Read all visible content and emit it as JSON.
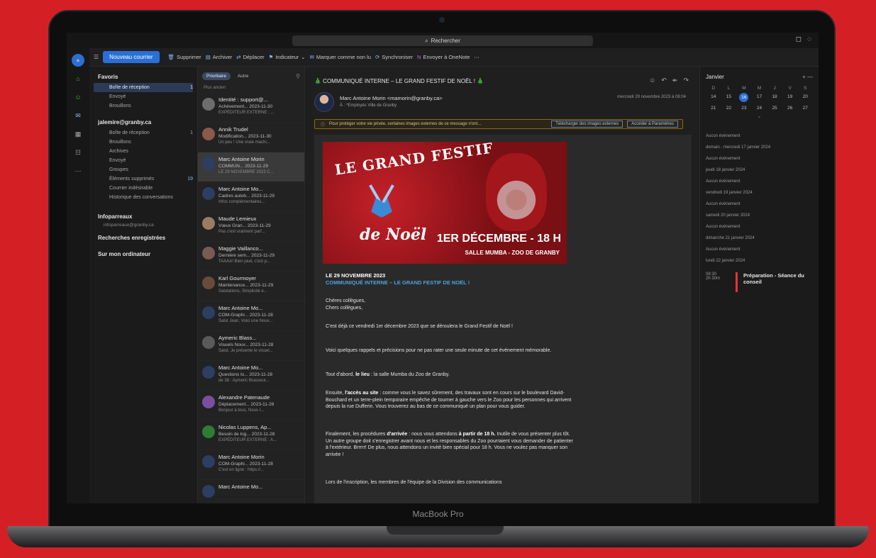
{
  "device": {
    "label": "MacBook Pro"
  },
  "search": {
    "placeholder": "Rechercher",
    "icon": "search-icon"
  },
  "toolbar": {
    "new_mail": "Nouveau courrier",
    "actions": [
      {
        "icon": "trash-icon",
        "label": "Supprimer"
      },
      {
        "icon": "archive-icon",
        "label": "Archiver"
      },
      {
        "icon": "move-icon",
        "label": "Déplacer"
      },
      {
        "icon": "flag-icon",
        "label": "Indicateur"
      },
      {
        "icon": "mark-read-icon",
        "label": "Marquer comme non lu"
      },
      {
        "icon": "sync-icon",
        "label": "Synchroniser"
      },
      {
        "icon": "onenote-icon",
        "label": "Envoyer à OneNote"
      }
    ]
  },
  "folders": {
    "favorites_label": "Favoris",
    "favorites": [
      {
        "label": "Boîte de réception",
        "count": "1"
      },
      {
        "label": "Envoyé",
        "count": ""
      },
      {
        "label": "Brouillons",
        "count": ""
      }
    ],
    "account_label": "jalemire@granby.ca",
    "account_items": [
      {
        "label": "Boîte de réception",
        "count": "1"
      },
      {
        "label": "Brouillons",
        "count": ""
      },
      {
        "label": "Archives",
        "count": ""
      },
      {
        "label": "Envoyé",
        "count": ""
      },
      {
        "label": "Groupes",
        "count": ""
      },
      {
        "label": "Éléments supprimés",
        "count": "19"
      },
      {
        "label": "Courrier indésirable",
        "count": ""
      },
      {
        "label": "Historique des conversations",
        "count": ""
      }
    ],
    "shared_label": "Infoparreaux",
    "shared_sub": "infoparreaux@granby.ca",
    "saved_searches": "Recherches enregistrées",
    "on_computer": "Sur mon ordinateur"
  },
  "msglist": {
    "tab_focused": "Prioritaire",
    "tab_other": "Autre",
    "section": "Plus ancien",
    "messages": [
      {
        "from": "Identité : support@...",
        "subject": "Achèvement... 2023-11-30",
        "preview": "EXPÉDITEUR EXTERNE : ...",
        "avatar_color": "#6d6d6d"
      },
      {
        "from": "Annik Trudel",
        "subject": "Modification... 2023-11-30",
        "preview": "Un peu ! Une vraie machi...",
        "avatar_color": "#8a5a4a"
      },
      {
        "from": "Marc Antoine Morin",
        "subject": "COMMUN... 2023-11-29",
        "preview": "LE 29 NOVEMBRE 2023 C...",
        "avatar_color": "#2c3e62"
      },
      {
        "from": "Marc Antoine Mo...",
        "subject": "Cadres autob... 2023-11-29",
        "preview": "Infos complémentaires...",
        "avatar_color": "#2c3e62"
      },
      {
        "from": "Maude Lemieux",
        "subject": "Vœux Gran... 2023-11-29",
        "preview": "Pas c'est vraiment parf...",
        "avatar_color": "#9a7b64"
      },
      {
        "from": "Maggie Vaillanco...",
        "subject": "Dernière sem... 2023-11-29",
        "preview": "TAAAA! Bien joué, c'est p...",
        "avatar_color": "#7a5a52"
      },
      {
        "from": "Karl Gourmoyer",
        "subject": "Maintenance... 2023-11-29",
        "preview": "Salutations, Simplicité e...",
        "avatar_color": "#6a4a3a"
      },
      {
        "from": "Marc Antoine Mo...",
        "subject": "COM-Graphi... 2023-11-28",
        "preview": "Salut Jean, Voici une Nouv...",
        "avatar_color": "#2c3e62"
      },
      {
        "from": "Aymeric Blass...",
        "subject": "Visuels Nouv... 2023-11-28",
        "preview": "Salut, Je présente le visuel...",
        "avatar_color": "#5a5a5a"
      },
      {
        "from": "Marc Antoine Mo...",
        "subject": "Questions lo... 2023-11-28",
        "preview": "de 38 : Aymeric Brasseur...",
        "avatar_color": "#2c3e62"
      },
      {
        "from": "Alexandre Patenaude",
        "subject": "Déplacement... 2023-11-28",
        "preview": "Bonjour à tous, Nous r...",
        "avatar_color": "#7a4fa0"
      },
      {
        "from": "Nicolas Luppens, Ap...",
        "subject": "Besoin de log... 2023-11-28",
        "preview": "EXPÉDITEUR EXTERNE : A...",
        "avatar_color": "#2e7d32"
      },
      {
        "from": "Marc Antoine Morin",
        "subject": "COM-Graphi... 2023-11-28",
        "preview": "C'est en ligne : https://...",
        "avatar_color": "#2c3e62"
      },
      {
        "from": "Marc Antoine Mo...",
        "subject": "",
        "preview": "",
        "avatar_color": "#2c3e62"
      }
    ]
  },
  "reading": {
    "subject": "🎄 COMMUNIQUÉ INTERNE – LE GRAND FESTIF DE NOËL ! 🎄",
    "sender": "Marc Antoine Morin <mamorin@granby.ca>",
    "to": "À : *Employés Ville de Granby",
    "date": "mercredi 29 novembre 2023 à 08:04",
    "infobar_text": "Pour protéger votre vie privée, certaines images externes de ce message n'ont...",
    "infobar_btn1": "Télécharger des images externes",
    "infobar_btn2": "Accéder à Paramètres",
    "banner": {
      "title": "LE GRAND FESTIF",
      "subtitle": "de Noël",
      "date": "1ER DÉCEMBRE - 18 H",
      "place": "SALLE MUMBA - ZOO DE GRANBY"
    },
    "body": {
      "date": "LE 29 NOVEMBRE 2023",
      "headline": "COMMUNIQUÉ INTERNE – LE GRAND FESTIF DE NOËL !",
      "greet1": "Chères collègues,",
      "greet2": "Chers collègues,",
      "p1": "C'est déjà ce vendredi 1er décembre 2023 que se déroulera le Grand Festif de Noël !",
      "p2": "Voici quelques rappels et précisions pour ne pas rater une seule minute de cet événement mémorable.",
      "p3_pre": "Tout d'abord,",
      "p3_bold": "le lieu",
      "p3_post": ": la salle Mumba du Zoo de Granby.",
      "p4_pre": "Ensuite,",
      "p4_bold": "l'accès au site",
      "p4_post": ": comme vous le savez sûrement, des travaux sont en cours sur le boulevard David-Bouchard et un terre-plein temporaire empêche de tourner à gauche vers le Zoo pour les personnes qui arrivent depuis la rue Dufferin. Vous trouverez au bas de ce communiqué un plan pour vous guider.",
      "p5_pre": "Finalement, les procédures",
      "p5_bold": "d'arrivée",
      "p5_mid": ": nous vous attendons",
      "p5_bold2": "à partir de 18 h.",
      "p5_post": "Inutile de vous présenter plus tôt. Un autre groupe doit s'enregistrer avant nous et les responsables du Zoo pourraient vous demander de patienter à l'extérieur. Brrrrr! De plus, nous attendons un invité bien spécial pour 18 h. Vous ne voulez pas manquer son arrivée !",
      "p6": "Lors de l'inscription, les membres de l'équipe de la Division des communications"
    }
  },
  "calendar": {
    "month": "Janvier",
    "weekdays": [
      "D",
      "L",
      "M",
      "M",
      "J",
      "V",
      "S"
    ],
    "week1": [
      "14",
      "15",
      "16",
      "17",
      "18",
      "19",
      "20"
    ],
    "week2": [
      "21",
      "22",
      "23",
      "24",
      "25",
      "26",
      "27"
    ],
    "today": "16",
    "agenda": [
      "Aucun événement",
      "demain - mercredi 17 janvier 2024",
      "Aucun événement",
      "jeudi 18 janvier 2024",
      "Aucun événement",
      "vendredi 19 janvier 2024",
      "Aucun événement",
      "samedi 20 janvier 2024",
      "Aucun événement",
      "dimanche 21 janvier 2024",
      "Aucun événement",
      "lundi 22 janvier 2024"
    ],
    "event": {
      "time": "08:30",
      "duration": "2h 30m",
      "title": "Préparation - Séance du conseil"
    }
  }
}
